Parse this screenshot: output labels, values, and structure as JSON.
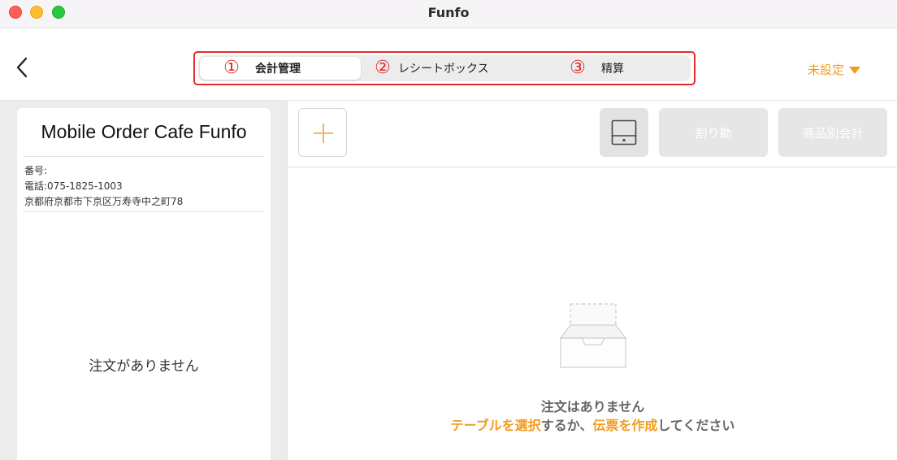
{
  "window": {
    "title": "Funfo"
  },
  "header": {
    "tabs": [
      {
        "number": "①",
        "label": "会計管理",
        "active": true
      },
      {
        "number": "②",
        "label": "レシートボックス",
        "active": false
      },
      {
        "number": "③",
        "label": "精算",
        "active": false
      }
    ],
    "filter": {
      "selected": "未設定"
    }
  },
  "receipt": {
    "shop_name": "Mobile Order Cafe Funfo",
    "number_label": "番号:",
    "phone": "電話:075-1825-1003",
    "address": "京都府京都市下京区万寿寺中之町78",
    "empty_message": "注文がありません"
  },
  "toolbar": {
    "split_label": "割り勘",
    "itemize_label": "商品別会計"
  },
  "empty_state": {
    "title": "注文はありません",
    "link_select_table": "テーブルを選択",
    "mid_text": "するか、",
    "link_create_slip": "伝票を作成",
    "end_text": "してください"
  },
  "colors": {
    "accent": "#f29b1c",
    "highlight_border": "#e52a2a"
  }
}
